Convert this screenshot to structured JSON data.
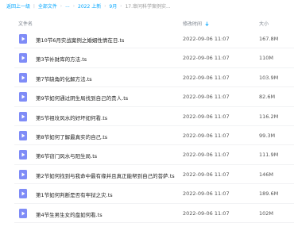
{
  "breadcrumb": {
    "back": "返回上一级",
    "all_files": "全部文件",
    "ellipsis": "...",
    "year": "2022 上新",
    "month": "9月",
    "current": "17.审问科学案例实..."
  },
  "header": {
    "name": "文件名",
    "modified": "修改时间",
    "size": "大小"
  },
  "files": [
    {
      "name": "第10节6月实战案例之婚姻性情在日.ts",
      "time": "2022-09-06 11:07",
      "size": "167.8M"
    },
    {
      "name": "第3节补财库的方法.ts",
      "time": "2022-09-06 11:07",
      "size": "110M"
    },
    {
      "name": "第7节缺角的化解方法.ts",
      "time": "2022-09-06 11:07",
      "size": "103.9M"
    },
    {
      "name": "第9节如何通过阴生局找到自己的贵人.ts",
      "time": "2022-09-06 11:07",
      "size": "82.6M"
    },
    {
      "name": "第5节祖坟风水的好坏如何看.ts",
      "time": "2022-09-06 11:07",
      "size": "116.2M"
    },
    {
      "name": "第8节如何了解最真实的自己.ts",
      "time": "2022-09-06 11:07",
      "size": "99.3M"
    },
    {
      "name": "第6节窃门风水与阳生局.ts",
      "time": "2022-09-06 11:07",
      "size": "111.9M"
    },
    {
      "name": "第2节如何找到与我命中最有缘并且真正能帮到自己的菩萨.ts",
      "time": "2022-09-06 11:07",
      "size": "146M"
    },
    {
      "name": "第1节如何判断是否有牢狱之灾.ts",
      "time": "2022-09-06 11:07",
      "size": "189.6M"
    },
    {
      "name": "第4节生男生女的盘如何看.ts",
      "time": "2022-09-06 11:07",
      "size": "102M"
    }
  ],
  "colors": {
    "link": "#06a7ff",
    "icon_bg": "#7f8cf7",
    "sort_icon": "#06a7ff"
  },
  "icons": {
    "file": "video-file-icon",
    "sort": "sort-desc-icon"
  }
}
